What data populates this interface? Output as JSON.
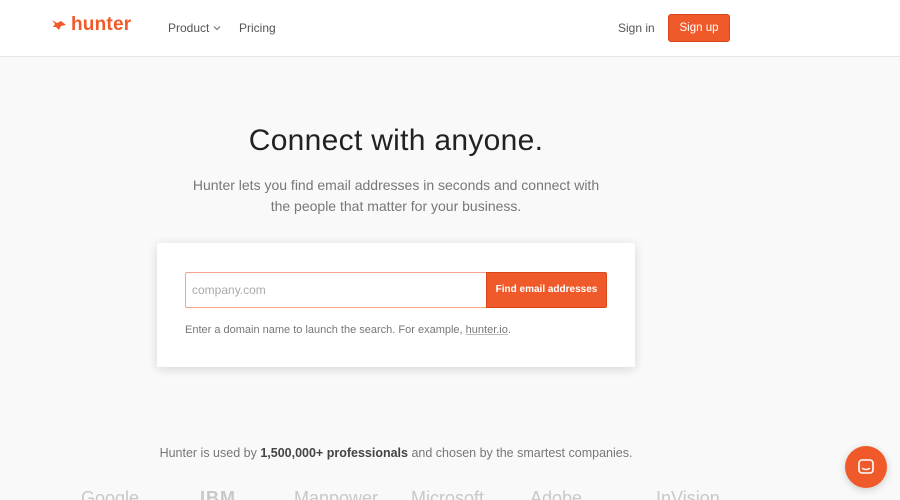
{
  "header": {
    "brand": "hunter",
    "nav": {
      "product": "Product",
      "pricing": "Pricing",
      "signin": "Sign in",
      "signup": "Sign up"
    }
  },
  "hero": {
    "title": "Connect with anyone.",
    "subtitle": "Hunter lets you find email addresses in seconds and connect with the people that matter for your business."
  },
  "search": {
    "placeholder": "company.com",
    "value": "",
    "button": "Find email addresses",
    "hint_prefix": "Enter a domain name to launch the search. For example,",
    "hint_link": "hunter.io",
    "hint_suffix": "."
  },
  "social_proof": {
    "prefix": "Hunter is used by",
    "highlight": "1,500,000+ professionals",
    "suffix": "and chosen by the smartest companies."
  },
  "logos": [
    "Google",
    "IBM",
    "Manpower",
    "Microsoft",
    "Adobe",
    "InVision"
  ],
  "colors": {
    "accent": "#f05a2b",
    "background": "#f8f9f8",
    "text_muted": "#777777"
  },
  "icons": {
    "brand": "fox-logo-icon",
    "chat": "chat-bubble-icon"
  }
}
